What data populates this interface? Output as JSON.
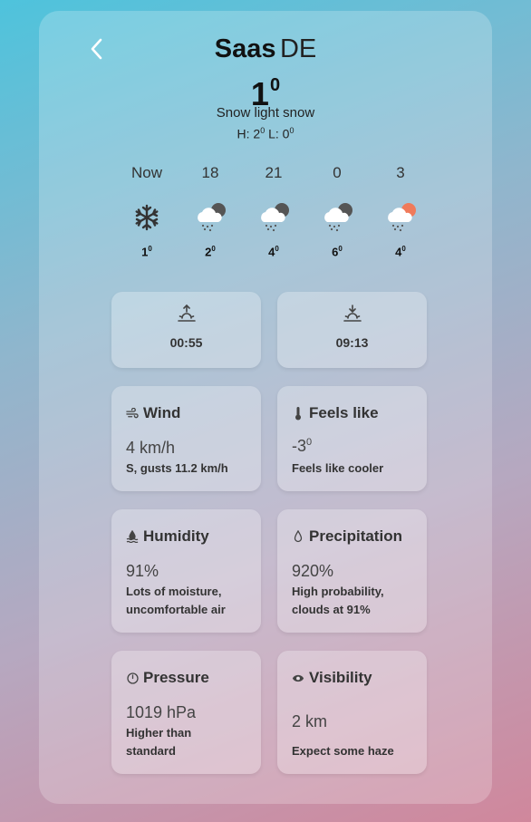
{
  "header": {
    "city": "Saas",
    "country": "DE",
    "temperature": "1",
    "degree": "0",
    "description": "Snow light snow",
    "hilo_h_label": "H: 2",
    "hilo_h_deg": "0",
    "hilo_l_label": " L: 0",
    "hilo_l_deg": "0"
  },
  "forecast": [
    {
      "time": "Now",
      "icon": "snowflake-icon",
      "temp": "1",
      "deg": "0"
    },
    {
      "time": "18",
      "icon": "cloud-snow-moon-icon",
      "temp": "2",
      "deg": "0"
    },
    {
      "time": "21",
      "icon": "cloud-snow-moon-icon",
      "temp": "4",
      "deg": "0"
    },
    {
      "time": "0",
      "icon": "cloud-snow-moon-icon",
      "temp": "6",
      "deg": "0"
    },
    {
      "time": "3",
      "icon": "cloud-snow-sun-icon",
      "temp": "4",
      "deg": "0"
    }
  ],
  "sunrise": {
    "icon": "sunrise-icon",
    "time": "00:55"
  },
  "sunset": {
    "icon": "sunset-icon",
    "time": "09:13"
  },
  "wind": {
    "icon": "wind-icon",
    "label": "Wind",
    "value": "4 km/h",
    "note": "S, gusts 11.2 km/h"
  },
  "feels_like": {
    "icon": "thermometer-icon",
    "label": "Feels like",
    "value": "-3",
    "deg": "0",
    "note": "Feels like cooler"
  },
  "humidity": {
    "icon": "humidity-icon",
    "label": "Humidity",
    "value": "91%",
    "note_line1": "Lots of moisture,",
    "note_line2": "uncomfortable air"
  },
  "precipitation": {
    "icon": "droplet-icon",
    "label": "Precipitation",
    "value": "920%",
    "note_line1": "High probability,",
    "note_line2": "clouds at 91%"
  },
  "pressure": {
    "icon": "gauge-icon",
    "label": "Pressure",
    "value": "1019 hPa",
    "note_line1": "Higher than",
    "note_line2": "standard"
  },
  "visibility": {
    "icon": "eye-icon",
    "label": "Visibility",
    "value": "2 km",
    "note": "Expect some haze"
  },
  "colors": {
    "moon": "#555555",
    "sun": "#f07a5a",
    "cloud": "#ffffff"
  }
}
